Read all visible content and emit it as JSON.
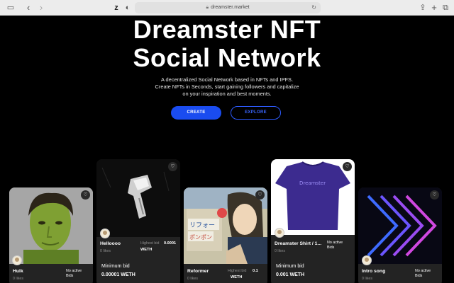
{
  "browser": {
    "url": "dreamster.market"
  },
  "hero": {
    "title_line1": "Dreamster NFT",
    "title_line2": "Social Network",
    "subtitle_line1": "A decentralized Social Network based in NFTs and IPFS.",
    "subtitle_line2": "Create NFTs in Seconds, start gaining followers and capitalize",
    "subtitle_line3": "on your inspiration and best moments.",
    "create_label": "CREATE",
    "explore_label": "EXPLORE"
  },
  "cards": [
    {
      "name": "Hulk",
      "likes": "0 likes",
      "status_line1": "No active",
      "status_line2": "Bids"
    },
    {
      "name": "Helloooo",
      "likes": "0 likes",
      "highest_bid_label": "Highest bid",
      "highest_bid_value": "0.0001",
      "currency": "WETH",
      "min_bid_label": "Minimum bid",
      "min_bid_value": "0.00001 WETH"
    },
    {
      "name": "Reformer",
      "likes": "0 likes",
      "highest_bid_label": "Highest bid",
      "highest_bid_value": "0.1",
      "currency": "WETH"
    },
    {
      "name": "Dreamster Shirt / 1...",
      "likes": "0 likes",
      "status_line1": "No active",
      "status_line2": "Bids",
      "min_bid_label": "Minimum bid",
      "min_bid_value": "0.001 WETH",
      "shirt_text": "Dreamster"
    },
    {
      "name": "Intro song",
      "likes": "0 likes",
      "status_line1": "No active",
      "status_line2": "Bids"
    }
  ]
}
